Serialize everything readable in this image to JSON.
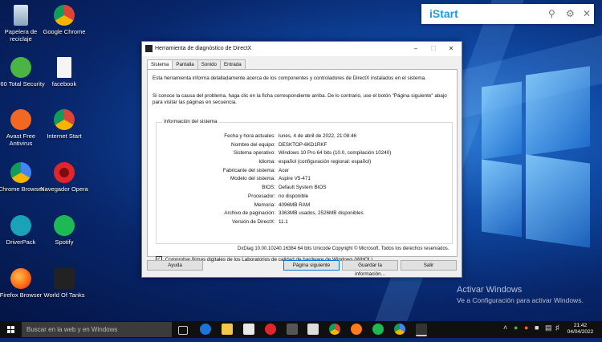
{
  "desktop_icons": [
    {
      "label": "Papelera de reciclaje",
      "icon": "recycle-bin-icon"
    },
    {
      "label": "Google Chrome",
      "icon": "chrome-icon"
    },
    {
      "label": "360 Total Security",
      "icon": "security-360-icon"
    },
    {
      "label": "facebook",
      "icon": "file-icon"
    },
    {
      "label": "Avast Free Antivirus",
      "icon": "avast-icon"
    },
    {
      "label": "Internet Start",
      "icon": "chrome-icon"
    },
    {
      "label": "Chrome Browser",
      "icon": "chrome-icon"
    },
    {
      "label": "Navegador Opera",
      "icon": "opera-icon"
    },
    {
      "label": "DriverPack",
      "icon": "driverpack-icon"
    },
    {
      "label": "Spotify",
      "icon": "spotify-icon"
    },
    {
      "label": "Firefox Browser",
      "icon": "firefox-icon"
    },
    {
      "label": "World Of Tanks",
      "icon": "world-of-tanks-icon"
    }
  ],
  "istart": {
    "brand": "iStart"
  },
  "watermark": {
    "line1": "Activar Windows",
    "line2": "Ve a Configuración para activar Windows."
  },
  "dxdiag": {
    "title": "Herramienta de diagnóstico de DirectX",
    "tabs": [
      "Sistema",
      "Pantalla",
      "Sonido",
      "Entrada"
    ],
    "intro": "Esta herramienta informa detalladamente acerca de los componentes y controladores de DirectX instalados en el sistema.",
    "intro2": "Si conoce la causa del problema, haga clic en la ficha correspondiente arriba. De lo contrario, use el botón \"Página siguiente\" abajo para visitar las páginas en secuencia.",
    "group_title": "Información del sistema",
    "rows": [
      {
        "k": "Fecha y hora actuales:",
        "v": "lunes, 4 de abril de 2022, 21:08:46"
      },
      {
        "k": "Nombre del equipo:",
        "v": "DESKTOP-6KD1RKF"
      },
      {
        "k": "Sistema operativo:",
        "v": "Windows 10 Pro 64 bits (10.0, compilación 10240)"
      },
      {
        "k": "Idioma:",
        "v": "español (configuración regional: español)"
      },
      {
        "k": "Fabricante del sistema:",
        "v": "Acer"
      },
      {
        "k": "Modelo del sistema:",
        "v": "Aspire V5-471"
      },
      {
        "k": "BIOS:",
        "v": "Default System BIOS"
      },
      {
        "k": "Procesador:",
        "v": "no disponible"
      },
      {
        "k": "Memoria:",
        "v": "4096MB RAM"
      },
      {
        "k": "Archivo de paginación:",
        "v": "3363MB usados, 2526MB disponibles"
      },
      {
        "k": "Versión de DirectX:",
        "v": "11.1"
      }
    ],
    "checkbox_label": "Comprobar firmas digitales de los Laboratorios de calidad de hardware de Windows (WHQL)",
    "footer": "DxDiag 10.00.10240.16384 64 bits Unicode  Copyright © Microsoft. Todos los derechos reservados.",
    "buttons": {
      "help": "Ayuda",
      "next": "Página siguiente",
      "save": "Guardar la información...",
      "exit": "Salir"
    }
  },
  "taskbar": {
    "search_placeholder": "Buscar en la web y en Windows",
    "time": "21:42",
    "date": "04/04/2022"
  }
}
